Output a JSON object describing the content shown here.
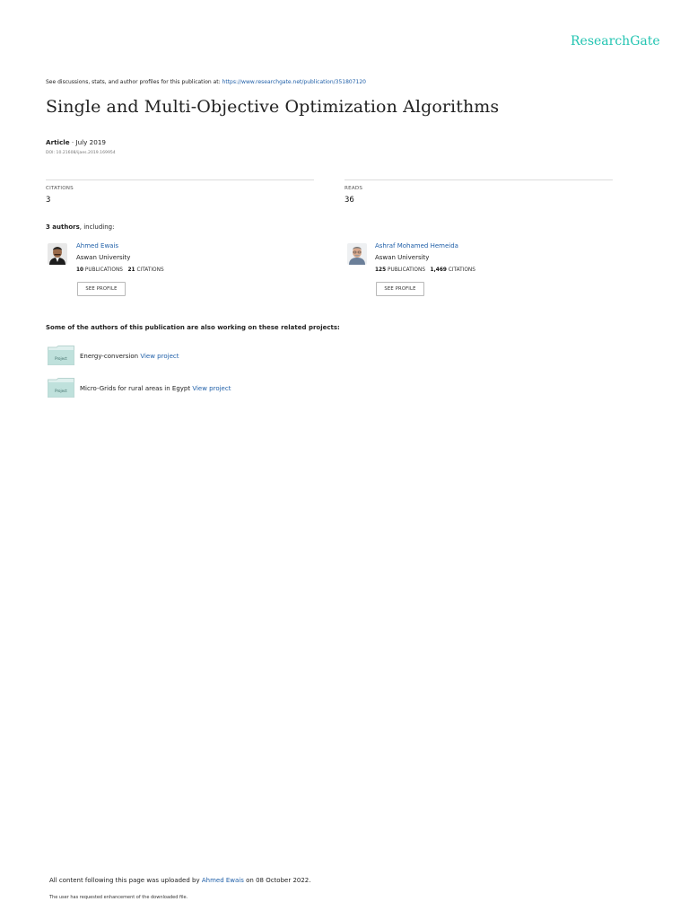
{
  "header": {
    "logo": "ResearchGate"
  },
  "discussion": {
    "prefix": "See discussions, stats, and author profiles for this publication at: ",
    "url": "https://www.researchgate.net/publication/351807120"
  },
  "publication": {
    "title": "Single and Multi-Objective Optimization Algorithms",
    "type": "Article",
    "date": " · July 2019",
    "doi": "DOI: 10.21608/ijaes.2019.169954"
  },
  "stats": {
    "citations_label": "CITATIONS",
    "citations_value": "3",
    "reads_label": "READS",
    "reads_value": "36"
  },
  "authors_heading": {
    "count": "3 authors",
    "suffix": ", including:"
  },
  "authors": [
    {
      "name": "Ahmed Ewais",
      "institution": "Aswan University",
      "publications_count": "10",
      "publications_label": "PUBLICATIONS",
      "citations_count": "21",
      "citations_label": "CITATIONS",
      "button": "SEE PROFILE"
    },
    {
      "name": "Ashraf Mohamed Hemeida",
      "institution": "Aswan University",
      "publications_count": "125",
      "publications_label": "PUBLICATIONS",
      "citations_count": "1,469",
      "citations_label": "CITATIONS",
      "button": "SEE PROFILE"
    }
  ],
  "projects_heading": "Some of the authors of this publication are also working on these related projects:",
  "projects": [
    {
      "icon_label": "Project",
      "name": "Energy-conversion ",
      "link": "View project"
    },
    {
      "icon_label": "Project",
      "name": "Micro-Grids for rural areas in Egypt ",
      "link": "View project"
    }
  ],
  "footer": {
    "prefix": "All content following this page was uploaded by ",
    "uploader": "Ahmed Ewais",
    "suffix": " on 08 October 2022.",
    "note": "The user has requested enhancement of the downloaded file."
  }
}
